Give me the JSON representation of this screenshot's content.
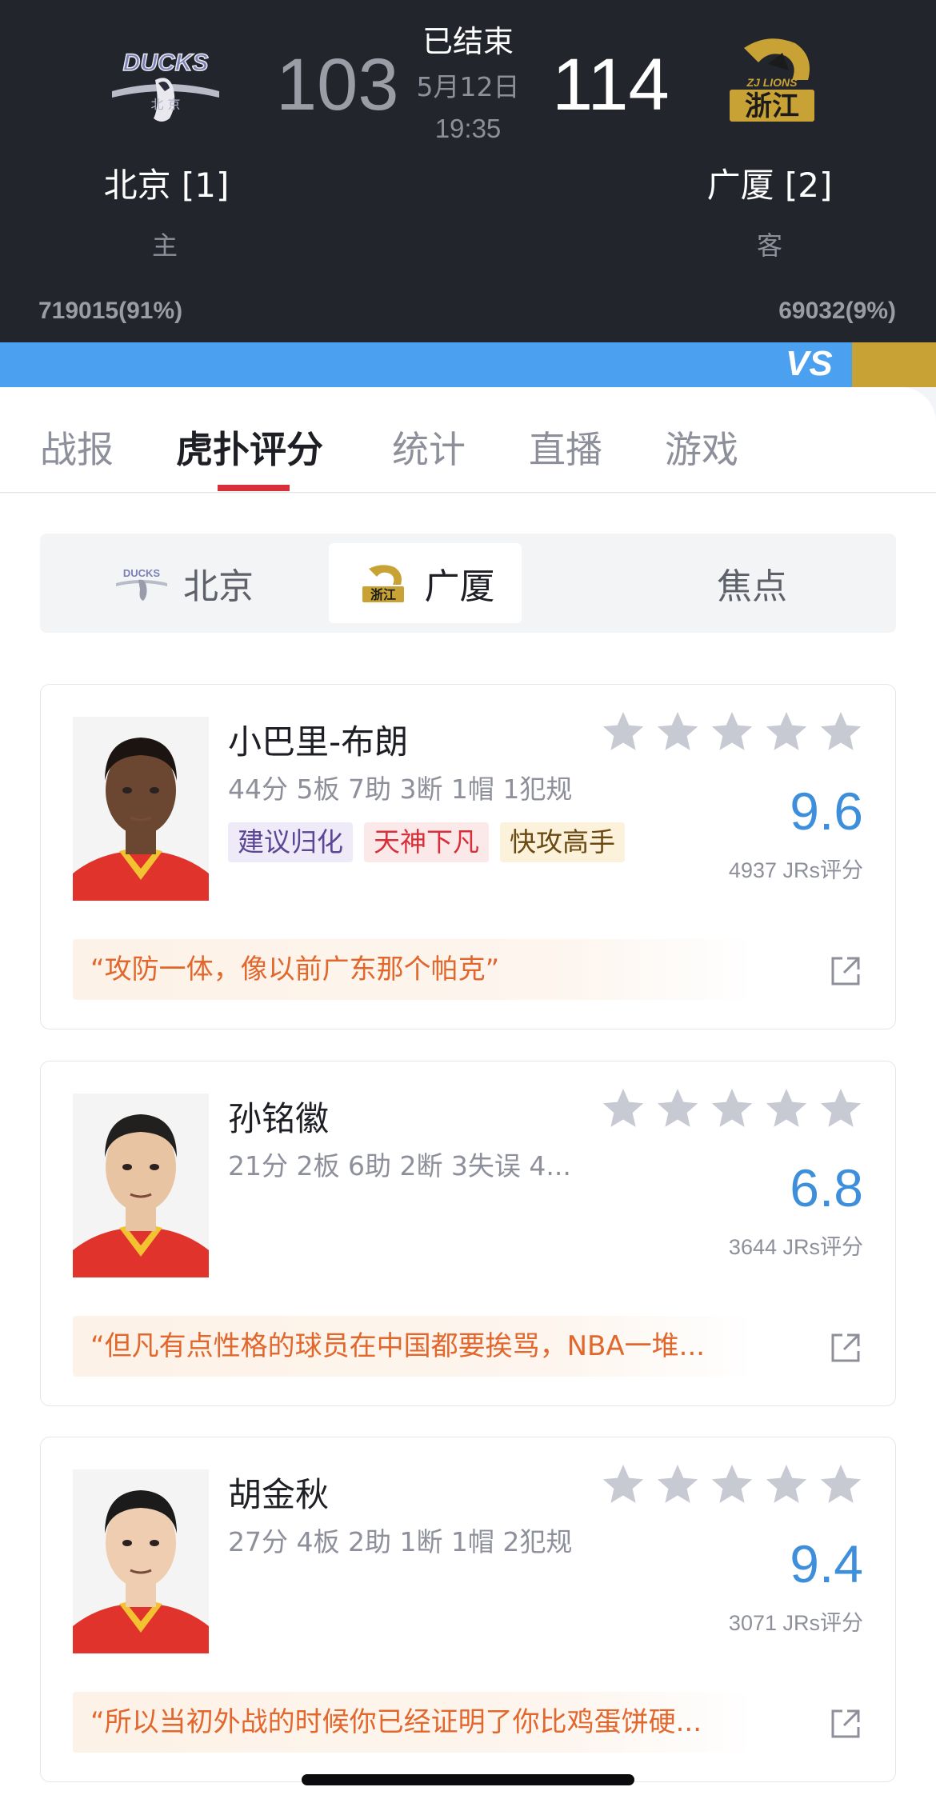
{
  "game": {
    "status": "已结束",
    "date": "5月12日",
    "time": "19:35",
    "home": {
      "logo_text": "DUCKS",
      "logo_sub": "北 京",
      "score": "103",
      "name": "北京 [1]",
      "role": "主",
      "votes": "719015(91%)",
      "vote_share": 0.91
    },
    "away": {
      "logo_text": "ZJ LIONS",
      "logo_sub": "浙江",
      "score": "114",
      "name": "广厦 [2]",
      "role": "客",
      "votes": "69032(9%)",
      "vote_share": 0.09
    },
    "vs_label": "VS"
  },
  "colors": {
    "home_bar": "#4ba0f0",
    "away_bar": "#c9a236",
    "rating_blue": "#3d8fdc",
    "tab_indicator": "#d8303a",
    "comment_text": "#e2672d"
  },
  "tabs": [
    {
      "label": "战报",
      "active": false
    },
    {
      "label": "虎扑评分",
      "active": true
    },
    {
      "label": "统计",
      "active": false
    },
    {
      "label": "直播",
      "active": false
    },
    {
      "label": "游戏",
      "active": false
    }
  ],
  "subtabs": [
    {
      "label": "北京",
      "icon": "ducks-logo-icon",
      "active": false
    },
    {
      "label": "广厦",
      "icon": "lions-logo-icon",
      "active": true
    },
    {
      "label": "焦点",
      "active": false
    }
  ],
  "players": [
    {
      "name": "小巴里-布朗",
      "stats": "44分 5板 7助 3断 1帽 1犯规",
      "tags": [
        {
          "label": "建议归化",
          "bg": "#efeaf8",
          "color": "#5b4796"
        },
        {
          "label": "天神下凡",
          "bg": "#fbe9ea",
          "color": "#d8303a"
        },
        {
          "label": "快攻高手",
          "bg": "#fcf1db",
          "color": "#6a4a12"
        }
      ],
      "rating": "9.6",
      "rating_count": "4937 JRs评分",
      "comment": "“攻防一体，像以前广东那个帕克”",
      "skin": "#6b4630",
      "hair": "#1b1410"
    },
    {
      "name": "孙铭徽",
      "stats": "21分 2板 6助 2断 3失误 4...",
      "tags": [],
      "rating": "6.8",
      "rating_count": "3644 JRs评分",
      "comment": "“但凡有点性格的球员在中国都要挨骂，NBA一堆...",
      "skin": "#e9c4a2",
      "hair": "#22201f"
    },
    {
      "name": "胡金秋",
      "stats": "27分 4板 2助 1断 1帽 2犯规",
      "tags": [],
      "rating": "9.4",
      "rating_count": "3071 JRs评分",
      "comment": "“所以当初外战的时候你已经证明了你比鸡蛋饼硬...",
      "skin": "#efcdb0",
      "hair": "#1c1b1b"
    }
  ]
}
